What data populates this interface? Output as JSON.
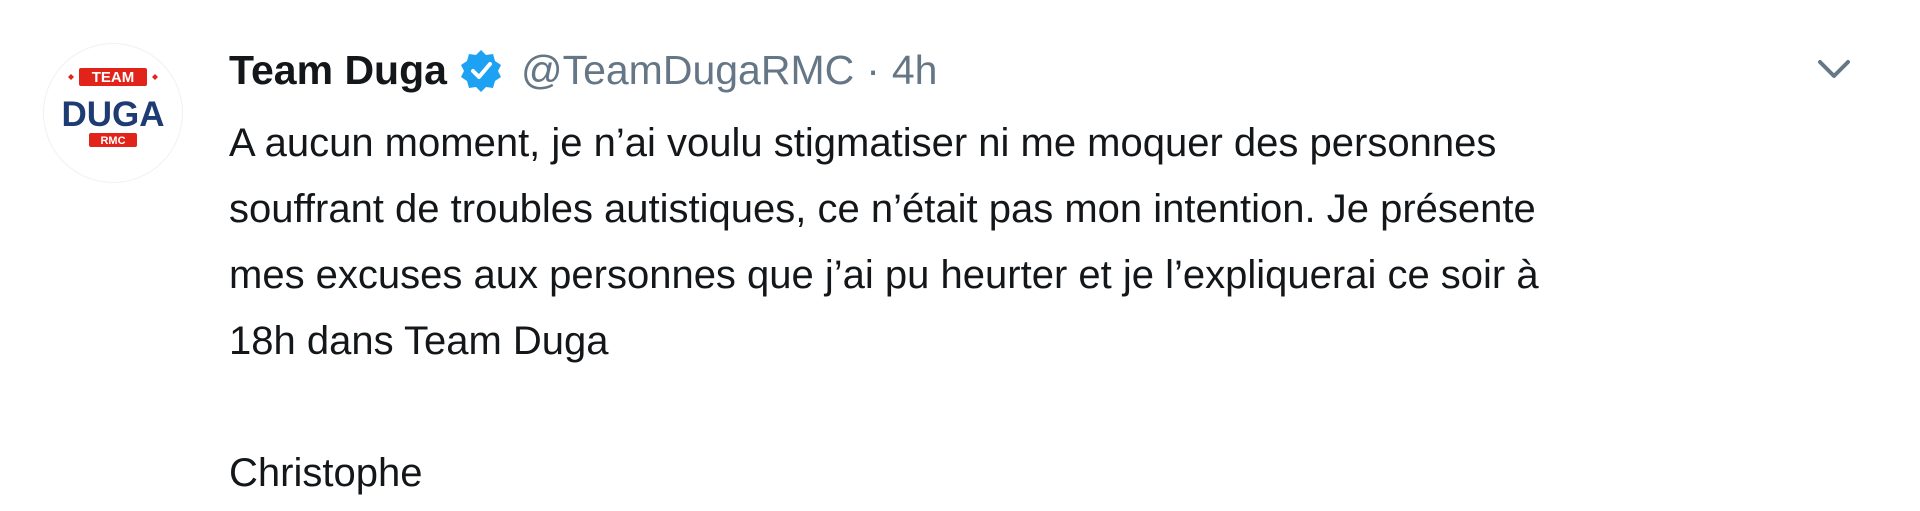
{
  "tweet": {
    "display_name": "Team Duga",
    "handle": "@TeamDugaRMC",
    "separator": "·",
    "time": "4h",
    "text_lines": [
      "A aucun moment, je n’ai voulu stigmatiser ni me moquer des personnes",
      "souffrant de troubles autistiques, ce n’était pas mon intention. Je présente",
      "mes excuses aux personnes que j’ai pu heurter et je l’expliquerai ce soir à",
      "18h dans Team Duga"
    ],
    "signature": "Christophe"
  },
  "avatar": {
    "logo_top": "TEAM",
    "logo_main": "DUGA",
    "logo_bottom": "RMC"
  },
  "icons": {
    "verified": "verified-badge-icon",
    "more": "chevron-down-icon"
  },
  "colors": {
    "name": "#14171a",
    "secondary": "#657786",
    "verified": "#1da1f2",
    "logo_red": "#e2231a",
    "logo_blue": "#1f3b73"
  }
}
